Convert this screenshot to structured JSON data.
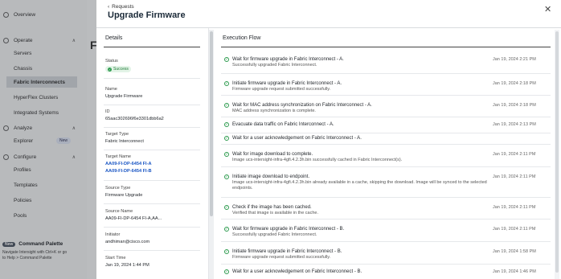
{
  "background": {
    "nav": [
      {
        "label": "Overview"
      },
      {
        "label": "Operate"
      },
      {
        "label": "Servers"
      },
      {
        "label": "Chassis"
      },
      {
        "label": "Fabric Interconnects"
      },
      {
        "label": "HyperFlex Clusters"
      },
      {
        "label": "Integrated Systems"
      },
      {
        "label": "Analyze"
      },
      {
        "label": "Explorer",
        "badge": "New"
      },
      {
        "label": "Configure"
      },
      {
        "label": "Profiles"
      },
      {
        "label": "Templates"
      },
      {
        "label": "Policies"
      },
      {
        "label": "Pools"
      }
    ],
    "page_title_partial": "Fa",
    "command_palette": {
      "badge": "New",
      "title": "Command Palette",
      "line1": "Navigate Intersight with Ctrl+K or go",
      "line2": "to Help > Command Palette"
    }
  },
  "drawer": {
    "back_label": "Requests",
    "title": "Upgrade Firmware",
    "close_icon": "close-icon"
  },
  "details": {
    "heading": "Details",
    "status_label": "Status",
    "status_value": "Success",
    "status_color": "#2e9b4f",
    "name_label": "Name",
    "name_value": "Upgrade Firmware",
    "id_label": "ID",
    "id_value": "65aac302696f6e3301dbb6a2",
    "target_type_label": "Target Type",
    "target_type_value": "Fabric Interconnect",
    "target_name_label": "Target Name",
    "target_name_a": "AA09-FI-DP-6454 FI-A",
    "target_name_b": "AA09-FI-DP-6454 FI-B",
    "source_type_label": "Source Type",
    "source_type_value": "Firmware Upgrade",
    "source_name_label": "Source Name",
    "source_name_value": "AA09-FI-DP-6454 FI-A,AA...",
    "initiator_label": "Initiator",
    "initiator_value": "andhiman@cisco.com",
    "start_time_label": "Start Time",
    "start_time_value": "Jan 19, 2024 1:44 PM"
  },
  "execution_flow": {
    "heading": "Execution Flow",
    "items": [
      {
        "title": "Wait for firmware upgrade in Fabric Interconnect - A.",
        "desc": "Successfully upgraded Fabric Interconnect.",
        "time": "Jan 19, 2024 2:21 PM"
      },
      {
        "title": "Initiate firmware upgrade in Fabric Interconnect - A.",
        "desc": "Firmware upgrade request submitted successfully.",
        "time": "Jan 19, 2024 2:18 PM"
      },
      {
        "title": "Wait for MAC address synchronization on Fabric Interconnect - A.",
        "desc": "MAC address synchronization is complete.",
        "time": "Jan 19, 2024 2:18 PM"
      },
      {
        "title": "Evacuate data traffic on Fabric Interconnect - A.",
        "desc": "",
        "time": "Jan 19, 2024 2:13 PM"
      },
      {
        "title": "Wait for a user acknowledgement on Fabric Interconnect - A.",
        "desc": "",
        "time": ""
      },
      {
        "title": "Wait for image download to complete.",
        "desc": "Image ucs-intersight-infra-4gfi.4.2.3h.bin successfully cached in Fabric Interconnect(s).",
        "time": "Jan 19, 2024 2:11 PM"
      },
      {
        "title": "Initiate image download to endpoint.",
        "desc": "Image ucs-intersight-infra-4gfi.4.2.3h.bin already available in a cache, skipping the download. Image will be synced to the selected endpoints.",
        "time": "Jan 19, 2024 2:11 PM"
      },
      {
        "title": "Check if the image has been cached.",
        "desc": "Verified that image is available in the cache.",
        "time": "Jan 19, 2024 2:11 PM"
      },
      {
        "title": "Wait for firmware upgrade in Fabric Interconnect - B.",
        "desc": "Successfully upgraded Fabric Interconnect.",
        "time": "Jan 19, 2024 2:11 PM"
      },
      {
        "title": "Initiate firmware upgrade in Fabric Interconnect - B.",
        "desc": "Firmware upgrade request submitted successfully.",
        "time": "Jan 19, 2024 1:58 PM"
      },
      {
        "title": "Wait for a user acknowledgement on Fabric Interconnect - B.",
        "desc": "",
        "time": "Jan 19, 2024 1:46 PM"
      }
    ]
  }
}
